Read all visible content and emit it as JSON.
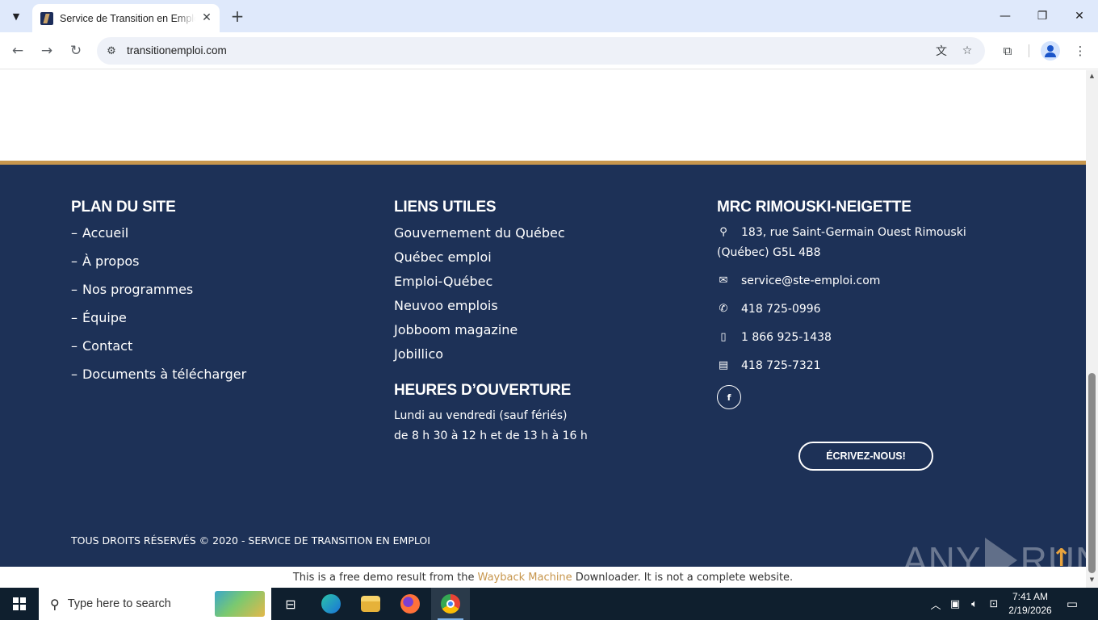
{
  "browser": {
    "tab_title": "Service de Transition en Emploi",
    "url": "transitionemploi.com"
  },
  "footer": {
    "site_map": {
      "title": "PLAN DU SITE",
      "items": [
        "Accueil",
        "À propos",
        "Nos programmes",
        "Équipe",
        "Contact",
        "Documents à télécharger"
      ]
    },
    "useful_links": {
      "title": "LIENS UTILES",
      "items": [
        "Gouvernement du Québec",
        "Québec emploi",
        "Emploi-Québec",
        "Neuvoo emplois",
        "Jobboom magazine",
        "Jobillico"
      ]
    },
    "hours": {
      "title": "HEURES D’OUVERTURE",
      "line1": "Lundi au vendredi (sauf fériés)",
      "line2": "de 8 h 30 à 12 h et de 13 h à 16 h"
    },
    "contact": {
      "title": "MRC RIMOUSKI-NEIGETTE",
      "address_line1": "183, rue Saint-Germain Ouest Rimouski",
      "address_line2": "(Québec) G5L 4B8",
      "email": "service@ste-emploi.com",
      "phone": "418 725-0996",
      "mobile": "1 866 925-1438",
      "fax": "418 725-7321",
      "facebook_label": "f",
      "cta_label": "ÉCRIVEZ-NOUS!"
    },
    "copyright": "TOUS DROITS RÉSERVÉS © 2020 - SERVICE DE TRANSITION EN EMPLOI"
  },
  "banner": {
    "prefix": "This is a free demo result from the",
    "link": "Wayback Machine",
    "suffix": "Downloader. It is not a complete website."
  },
  "watermark": {
    "left": "ANY",
    "right": "RUN"
  },
  "taskbar": {
    "search_placeholder": "Type here to search",
    "time": "7:41 AM",
    "date": "2/19/2026"
  },
  "colors": {
    "footer_bg": "#1d3157",
    "accent_gold": "#c7964d",
    "taskbar_bg": "#0f1f2e"
  }
}
